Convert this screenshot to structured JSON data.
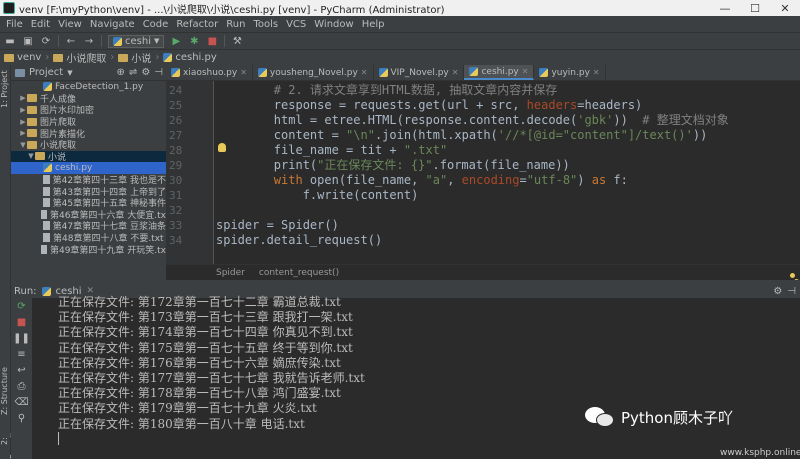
{
  "window": {
    "title": "venv [F:\\myPython\\venv] - ...\\小说爬取\\小说\\ceshi.py [venv] - PyCharm (Administrator)",
    "minimize": "—",
    "maximize": "☐",
    "close": "✕"
  },
  "menu": [
    "File",
    "Edit",
    "View",
    "Navigate",
    "Code",
    "Refactor",
    "Run",
    "Tools",
    "VCS",
    "Window",
    "Help"
  ],
  "toolbar": {
    "run_config": "ceshi"
  },
  "breadcrumbs": [
    "venv",
    "小说爬取",
    "小说",
    "ceshi.py"
  ],
  "project_panel": {
    "title": "Project",
    "tree": [
      {
        "label": "FaceDetection_1.py",
        "type": "py",
        "indent": 3,
        "arrow": ""
      },
      {
        "label": "千人成像",
        "type": "folder",
        "indent": 1,
        "arrow": "▶"
      },
      {
        "label": "图片水印加密",
        "type": "folder",
        "indent": 1,
        "arrow": "▶"
      },
      {
        "label": "图片爬取",
        "type": "folder",
        "indent": 1,
        "arrow": "▶"
      },
      {
        "label": "图片素描化",
        "type": "folder",
        "indent": 1,
        "arrow": "▶"
      },
      {
        "label": "小说爬取",
        "type": "folder",
        "indent": 1,
        "arrow": "▼"
      },
      {
        "label": "小说",
        "type": "folder",
        "indent": 2,
        "arrow": "▼",
        "selected": "dark"
      },
      {
        "label": "ceshi.py",
        "type": "py",
        "indent": 3,
        "arrow": "",
        "selected": "dark"
      },
      {
        "label": "第42章第四十三章 我也是不",
        "type": "txt",
        "indent": 3,
        "arrow": ""
      },
      {
        "label": "第43章第四十四章 上帝到了",
        "type": "txt",
        "indent": 3,
        "arrow": ""
      },
      {
        "label": "第45章第四十五章 神秘事件",
        "type": "txt",
        "indent": 3,
        "arrow": ""
      },
      {
        "label": "第46章第四十六章 大便宜.tx",
        "type": "txt",
        "indent": 3,
        "arrow": ""
      },
      {
        "label": "第47章第四十七章 豆浆油条",
        "type": "txt",
        "indent": 3,
        "arrow": ""
      },
      {
        "label": "第48章第四十八章 不要.txt",
        "type": "txt",
        "indent": 3,
        "arrow": ""
      },
      {
        "label": "第49章第四十九章 开玩笑.tx",
        "type": "txt",
        "indent": 3,
        "arrow": ""
      }
    ]
  },
  "editor": {
    "tabs": [
      {
        "label": "xiaoshuo.py",
        "active": false
      },
      {
        "label": "yousheng_Novel.py",
        "active": false
      },
      {
        "label": "VIP_Novel.py",
        "active": false
      },
      {
        "label": "ceshi.py",
        "active": true
      },
      {
        "label": "yuyin.py",
        "active": false
      }
    ],
    "lines": [
      {
        "n": "24",
        "t": "        # 2. 请求文章享到HTML数据, 抽取文章内容并保存"
      },
      {
        "n": "25",
        "t": "        response = requests.get(url + src, headers=headers)"
      },
      {
        "n": "26",
        "t": "        html = etree.HTML(response.content.decode('gbk'))  # 整理文档对象"
      },
      {
        "n": "27",
        "t": "        content = \"\\n\".join(html.xpath('//*[@id=\"content\"]/text()'))"
      },
      {
        "n": "28",
        "t": "        file_name = tit + \".txt\""
      },
      {
        "n": "29",
        "t": "        print(\"正在保存文件: {}\".format(file_name))"
      },
      {
        "n": "30",
        "t": "        with open(file_name, \"a\", encoding=\"utf-8\") as f:"
      },
      {
        "n": "31",
        "t": "            f.write(content)"
      },
      {
        "n": "32",
        "t": ""
      },
      {
        "n": "33",
        "t": "spider = Spider()"
      },
      {
        "n": "34",
        "t": "spider.detail_request()"
      }
    ],
    "crumbs": [
      "Spider",
      "content_request()"
    ]
  },
  "run_panel": {
    "label": "Run:",
    "config": "ceshi",
    "output": [
      "正在保存文件: 第172章第一百七十二章 霸道总裁.txt",
      "正在保存文件: 第173章第一百七十三章 跟我打一架.txt",
      "正在保存文件: 第174章第一百七十四章 你真见不到.txt",
      "正在保存文件: 第175章第一百七十五章 终于等到你.txt",
      "正在保存文件: 第176章第一百七十六章 嫡庶传染.txt",
      "正在保存文件: 第177章第一百七十七章 我就告诉老师.txt",
      "正在保存文件: 第178章第一百七十八章 鸿门盛宴.txt",
      "正在保存文件: 第179章第一百七十九章 火炎.txt",
      "正在保存文件: 第180章第一百八十章 电话.txt"
    ]
  },
  "side_tabs": {
    "project": "1: Project",
    "structure": "Z: Structure",
    "favorites": "2: Favorites"
  },
  "watermark": {
    "text": "Python顾木子吖",
    "url": "www.ksphp.online"
  },
  "colors": {
    "keyword": "#cc7832",
    "string": "#6a8759",
    "comment": "#808080",
    "param": "#aa4926",
    "accent": "#4a88c7"
  }
}
